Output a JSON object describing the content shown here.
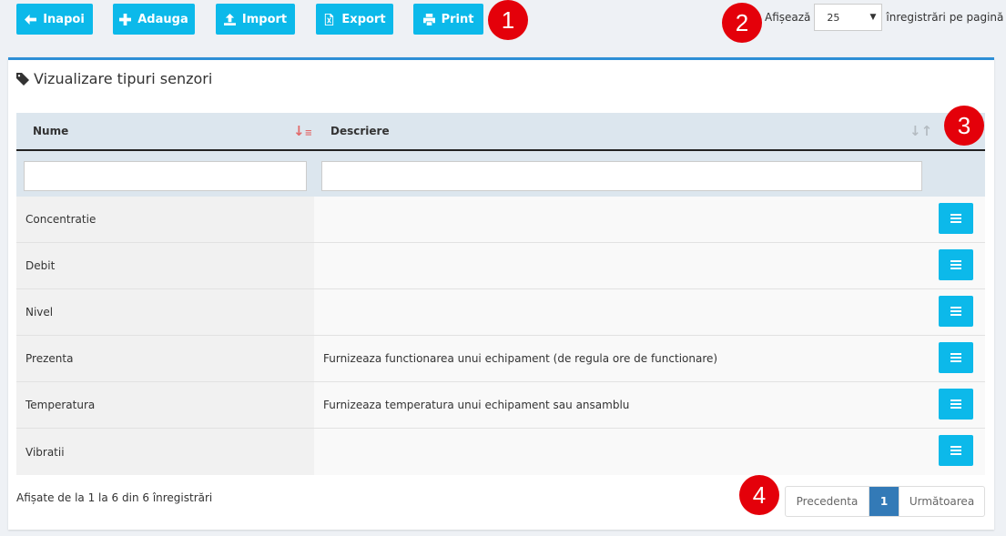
{
  "toolbar": {
    "back_label": "Inapoi",
    "add_label": "Adauga",
    "import_label": "Import",
    "export_label": "Export",
    "print_label": "Print"
  },
  "per_page": {
    "prefix": "Afișează",
    "value": "25",
    "suffix": "înregistrări pe pagină"
  },
  "badges": [
    "1",
    "2",
    "3",
    "4"
  ],
  "panel": {
    "title": "Vizualizare tipuri senzori"
  },
  "table": {
    "columns": [
      {
        "label": "Nume",
        "sort_icon": "sort-alpha-desc-icon"
      },
      {
        "label": "Descriere",
        "sort_icon": "sort-neutral-icon"
      }
    ],
    "filters": {
      "nume": "",
      "descriere": ""
    },
    "rows": [
      {
        "nume": "Concentratie",
        "descriere": ""
      },
      {
        "nume": "Debit",
        "descriere": ""
      },
      {
        "nume": "Nivel",
        "descriere": ""
      },
      {
        "nume": "Prezenta",
        "descriere": "Furnizeaza functionarea unui echipament (de regula ore de functionare)"
      },
      {
        "nume": "Temperatura",
        "descriere": "Furnizeaza temperatura unui echipament sau ansamblu"
      },
      {
        "nume": "Vibratii",
        "descriere": ""
      }
    ]
  },
  "footer": {
    "info": "Afișate de la 1 la 6 din 6 înregistrări",
    "prev_label": "Precedenta",
    "current_page": "1",
    "next_label": "Următoarea"
  },
  "colors": {
    "button": "#0cb9ea",
    "panel_border": "#2e8fd6",
    "header_bg": "#dce6ee",
    "badge": "#e4000a",
    "page_active": "#337ab7",
    "sort_active": "#e26a6a"
  }
}
